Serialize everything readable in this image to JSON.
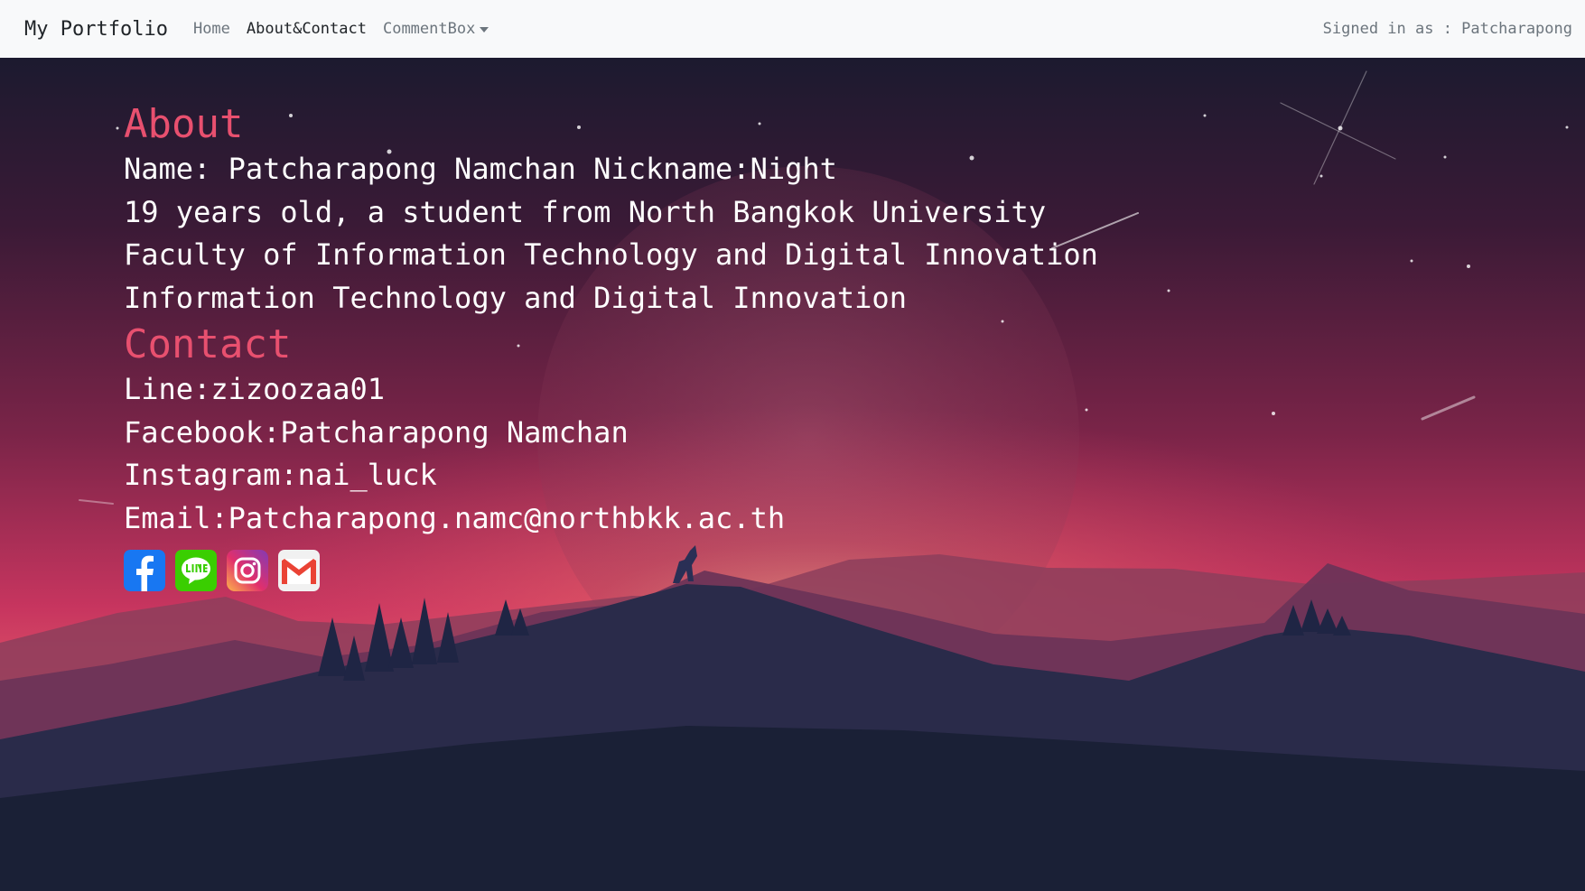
{
  "navbar": {
    "brand": "My Portfolio",
    "links": [
      {
        "label": "Home"
      },
      {
        "label": "About&Contact"
      },
      {
        "label": "CommentBox"
      }
    ],
    "signed_in": "Signed in as : Patcharapong"
  },
  "about": {
    "heading": "About",
    "lines": [
      "Name: Patcharapong Namchan Nickname:Night",
      "19 years old, a student from North Bangkok University",
      "Faculty of Information Technology and Digital Innovation",
      "Information Technology and Digital Innovation"
    ]
  },
  "contact": {
    "heading": "Contact",
    "lines": [
      "Line:zizoozaa01",
      "Facebook:Patcharapong Namchan",
      "Instagram:nai_luck",
      "Email:Patcharapong.namc@northbkk.ac.th"
    ]
  },
  "social_icons": [
    {
      "name": "facebook-icon",
      "color": "#1877f2"
    },
    {
      "name": "line-icon",
      "color": "#3ace01"
    },
    {
      "name": "instagram-icon",
      "color": "#e1306c"
    },
    {
      "name": "gmail-icon",
      "color": "#ea4335"
    }
  ],
  "colors": {
    "heading": "#e8506f",
    "text": "#ffffff",
    "navbar_bg": "#f8f9fa"
  }
}
